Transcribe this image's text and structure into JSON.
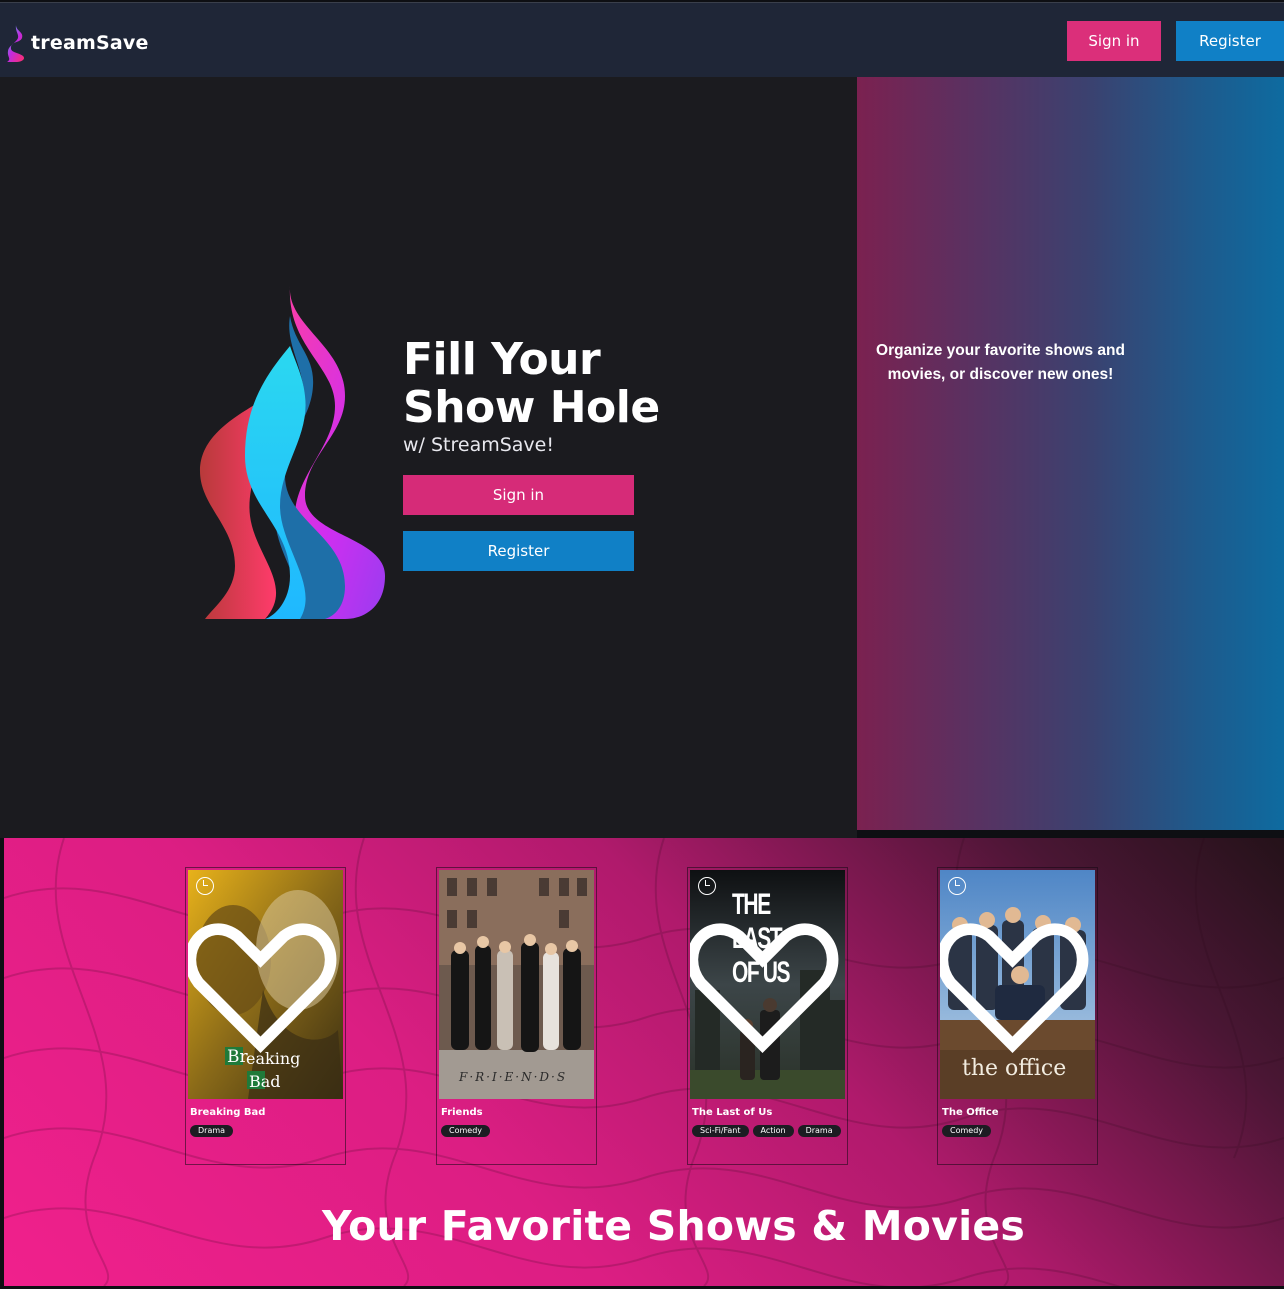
{
  "nav": {
    "brand": "treamSave",
    "signin_label": "Sign in",
    "register_label": "Register"
  },
  "hero": {
    "headline_line1": "Fill Your",
    "headline_line2": "Show Hole",
    "subline": "w/ StreamSave!",
    "signin_label": "Sign in",
    "register_label": "Register",
    "side_text": "Organize your favorite shows and movies, or discover new ones!"
  },
  "showcase": {
    "heading": "Your Favorite Shows & Movies",
    "cards": [
      {
        "title": "Breaking Bad",
        "tags": [
          "Drama"
        ],
        "poster_text1": "Br",
        "poster_text2": "eaking",
        "poster_text3": "Bad"
      },
      {
        "title": "Friends",
        "tags": [
          "Comedy"
        ],
        "poster_text1": "F·R·I·E·N·D·S"
      },
      {
        "title": "The Last of Us",
        "tags": [
          "Sci-Fi/Fant",
          "Action",
          "Drama"
        ],
        "poster_text1": "THE",
        "poster_text2": "LAST",
        "poster_text3": "OF US"
      },
      {
        "title": "The Office",
        "tags": [
          "Comedy"
        ],
        "poster_text1": "the office"
      }
    ]
  },
  "colors": {
    "nav_bg": "#1f2637",
    "signin_pink": "#d62b78",
    "register_blue": "#1080c6",
    "hero_bg": "#1b1b1f"
  },
  "icons": [
    "streamsave-logo-icon",
    "clock-icon",
    "heart-icon"
  ]
}
